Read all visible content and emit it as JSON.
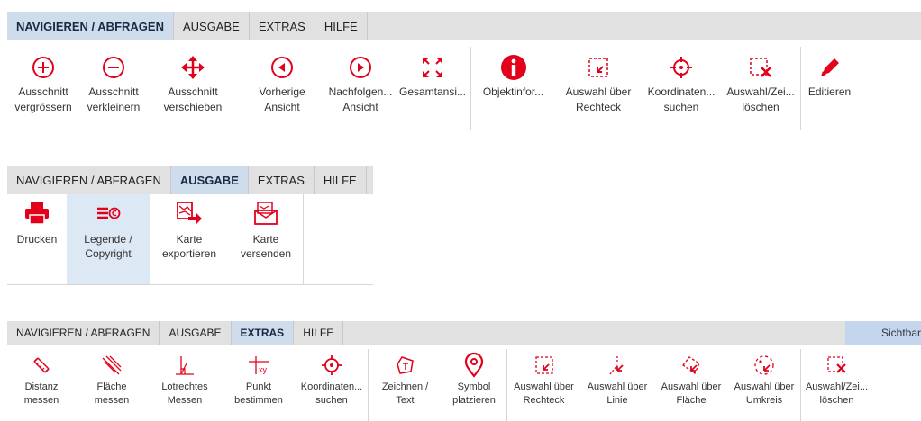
{
  "toolbar1": {
    "tabs": [
      "NAVIGIEREN / ABFRAGEN",
      "AUSGABE",
      "EXTRAS",
      "HILFE"
    ],
    "buttons": [
      {
        "label": "Ausschnitt\nvergrössern",
        "icon": "zoom-in-icon"
      },
      {
        "label": "Ausschnitt\nverkleinern",
        "icon": "zoom-out-icon"
      },
      {
        "label": "Ausschnitt\nverschieben",
        "icon": "pan-arrows-icon"
      },
      {
        "label": "Vorherige\nAnsicht",
        "icon": "previous-view-icon"
      },
      {
        "label": "Nachfolgen...\nAnsicht",
        "icon": "next-view-icon"
      },
      {
        "label": "Gesamtansi...",
        "icon": "full-extent-icon"
      },
      {
        "label": "Objektinfor...",
        "icon": "info-icon"
      },
      {
        "label": "Auswahl über\nRechteck",
        "icon": "select-rectangle-icon"
      },
      {
        "label": "Koordinaten...\nsuchen",
        "icon": "crosshair-icon"
      },
      {
        "label": "Auswahl/Zei...\nlöschen",
        "icon": "clear-selection-icon"
      },
      {
        "label": "Editieren",
        "icon": "pencil-icon"
      }
    ]
  },
  "toolbar2": {
    "tabs": [
      "NAVIGIEREN / ABFRAGEN",
      "AUSGABE",
      "EXTRAS",
      "HILFE"
    ],
    "buttons": [
      {
        "label": "Drucken",
        "icon": "printer-icon"
      },
      {
        "label": "Legende /\nCopyright",
        "icon": "legend-copyright-icon"
      },
      {
        "label": "Karte\nexportieren",
        "icon": "map-export-icon"
      },
      {
        "label": "Karte\nversenden",
        "icon": "map-send-icon"
      }
    ]
  },
  "toolbar3": {
    "tabs": [
      "NAVIGIEREN / ABFRAGEN",
      "AUSGABE",
      "EXTRAS",
      "HILFE"
    ],
    "right_label": "Sichtbar",
    "buttons": [
      {
        "label": "Distanz\nmessen",
        "icon": "measure-distance-icon"
      },
      {
        "label": "Fläche\nmessen",
        "icon": "measure-area-icon"
      },
      {
        "label": "Lotrechtes\nMessen",
        "icon": "perpendicular-measure-icon"
      },
      {
        "label": "Punkt\nbestimmen",
        "icon": "point-xy-icon"
      },
      {
        "label": "Koordinaten...\nsuchen",
        "icon": "crosshair-icon"
      },
      {
        "label": "Zeichnen /\nText",
        "icon": "draw-text-icon"
      },
      {
        "label": "Symbol\nplatzieren",
        "icon": "map-pin-icon"
      },
      {
        "label": "Auswahl über\nRechteck",
        "icon": "select-rectangle-icon"
      },
      {
        "label": "Auswahl über\nLinie",
        "icon": "select-line-icon"
      },
      {
        "label": "Auswahl über\nFläche",
        "icon": "select-polygon-icon"
      },
      {
        "label": "Auswahl über\nUmkreis",
        "icon": "select-circle-icon"
      },
      {
        "label": "Auswahl/Zei...\nlöschen",
        "icon": "clear-selection-icon"
      }
    ]
  },
  "colors": {
    "accent": "#e3001b",
    "active_tab": "#cfdcec",
    "tabbar": "#e1e1e1"
  }
}
